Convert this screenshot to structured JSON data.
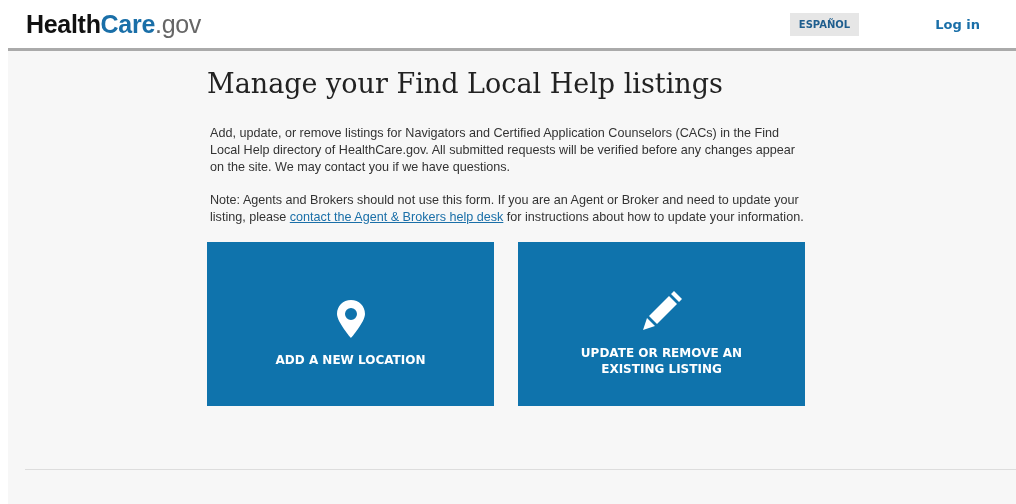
{
  "header": {
    "logo": [
      {
        "text": "Health",
        "kind": "dark"
      },
      {
        "text": "Care",
        "kind": "accent"
      },
      {
        "text": ".gov",
        "kind": "light"
      }
    ],
    "language_button": "ESPAÑOL",
    "login_link": "Log in"
  },
  "page": {
    "title": "Manage your Find Local Help listings",
    "intro": "Add, update, or remove listings for Navigators and Certified Application Counselors (CACs) in the Find Local Help directory of HealthCare.gov. All submitted requests will be verified before any changes appear on the site. We may contact you if we have questions.",
    "note": {
      "before": "Note: Agents and Brokers should not use this form. If you are an Agent or Broker and need to update your listing, please",
      "link": "contact the Agent & Brokers help desk",
      "after": "for instructions about how to update your information."
    },
    "actions": [
      {
        "kind": "location",
        "label": "ADD A NEW LOCATION"
      },
      {
        "kind": "edit",
        "label": "UPDATE OR REMOVE AN EXISTING LISTING"
      }
    ]
  }
}
